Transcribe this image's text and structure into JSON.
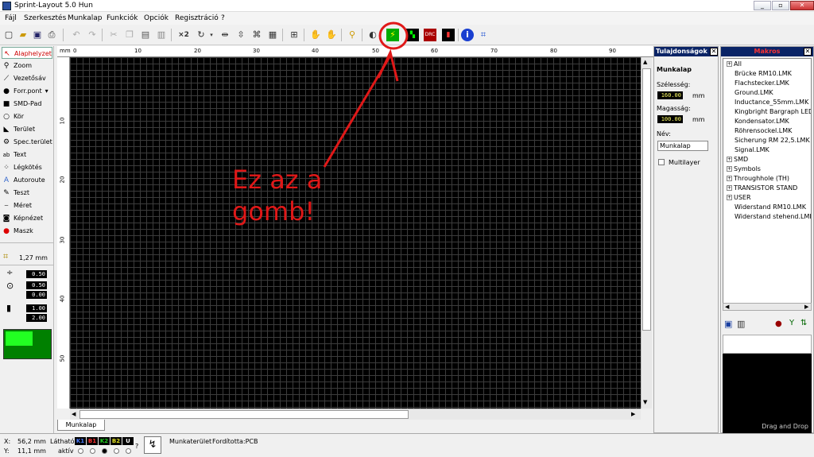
{
  "window": {
    "title": "Sprint-Layout 5.0 Hun"
  },
  "menu": [
    "Fájl",
    "Szerkesztés",
    "Munkalap",
    "Funkciók",
    "Opciók",
    "Regisztráció",
    "?"
  ],
  "tools": [
    {
      "label": "Alaphelyzet",
      "icon": "pointer-icon"
    },
    {
      "label": "Zoom",
      "icon": "magnifier-icon"
    },
    {
      "label": "Vezetősáv",
      "icon": "track-icon"
    },
    {
      "label": "Forr.pont",
      "icon": "pad-icon"
    },
    {
      "label": "SMD-Pad",
      "icon": "smd-icon"
    },
    {
      "label": "Kör",
      "icon": "circle-icon"
    },
    {
      "label": "Terület",
      "icon": "area-icon"
    },
    {
      "label": "Spec.terület",
      "icon": "special-area-icon"
    },
    {
      "label": "Text",
      "icon": "text-icon"
    },
    {
      "label": "Légkötés",
      "icon": "airwire-icon"
    },
    {
      "label": "Autoroute",
      "icon": "autoroute-icon"
    },
    {
      "label": "Teszt",
      "icon": "test-icon"
    },
    {
      "label": "Méret",
      "icon": "measure-icon"
    },
    {
      "label": "Képnézet",
      "icon": "camera-icon"
    },
    {
      "label": "Maszk",
      "icon": "mask-icon"
    }
  ],
  "grid": {
    "label": "1,27 mm"
  },
  "values": {
    "track_width": "0.50",
    "pad_outer": "0.50",
    "pad_inner": "0.00",
    "smd_w": "1.00",
    "smd_h": "2.00"
  },
  "ruler": {
    "unit": "mm",
    "top_ticks": [
      "0",
      "10",
      "20",
      "30",
      "40",
      "50",
      "60",
      "70",
      "80",
      "90"
    ],
    "left_ticks": [
      "10",
      "20",
      "30",
      "40",
      "50"
    ]
  },
  "sheet_tab": "Munkalap",
  "properties": {
    "title": "Tulajdonságok",
    "section": "Munkalap",
    "width_label": "Szélesség:",
    "width_value": "160.00",
    "height_label": "Magasság:",
    "height_value": "100.00",
    "unit": "mm",
    "name_label": "Név:",
    "name_value": "Munkalap",
    "multilayer": "Multilayer"
  },
  "macros": {
    "title": "Makros",
    "items": [
      {
        "label": "All",
        "expandable": true
      },
      {
        "label": "Brücke RM10.LMK",
        "expandable": false
      },
      {
        "label": "Flachstecker.LMK",
        "expandable": false
      },
      {
        "label": "Ground.LMK",
        "expandable": false
      },
      {
        "label": "Inductance_55mm.LMK",
        "expandable": false
      },
      {
        "label": "Kingbright Bargraph LED.LMK",
        "expandable": false
      },
      {
        "label": "Kondensator.LMK",
        "expandable": false
      },
      {
        "label": "Röhrensockel.LMK",
        "expandable": false
      },
      {
        "label": "Sicherung RM 22,5.LMK",
        "expandable": false
      },
      {
        "label": "Signal.LMK",
        "expandable": false
      },
      {
        "label": "SMD",
        "expandable": true
      },
      {
        "label": "Symbols",
        "expandable": true
      },
      {
        "label": "Throughhole (TH)",
        "expandable": true
      },
      {
        "label": "TRANSISTOR STAND",
        "expandable": true
      },
      {
        "label": "USER",
        "expandable": true
      },
      {
        "label": "Widerstand RM10.LMK",
        "expandable": false
      },
      {
        "label": "Widerstand stehend.LMK",
        "expandable": false
      }
    ],
    "drag_drop": "Drag and Drop"
  },
  "status": {
    "x_label": "X:",
    "x_value": "56,2 mm",
    "y_label": "Y:",
    "y_value": "11,1 mm",
    "visible_label": "Látható",
    "active_label": "aktív",
    "layers": [
      {
        "name": "K1",
        "color": "#4a7bff"
      },
      {
        "name": "B1",
        "color": "#ff3030"
      },
      {
        "name": "K2",
        "color": "#20d020"
      },
      {
        "name": "B2",
        "color": "#e0e020"
      },
      {
        "name": "U",
        "color": "#ffffff"
      }
    ],
    "help": "?",
    "workspace": "Munkaterület",
    "translator": "Fordította:PCB"
  },
  "annotation": {
    "line1": "Ez az a",
    "line2": "gomb!",
    "color": "#e01818"
  }
}
